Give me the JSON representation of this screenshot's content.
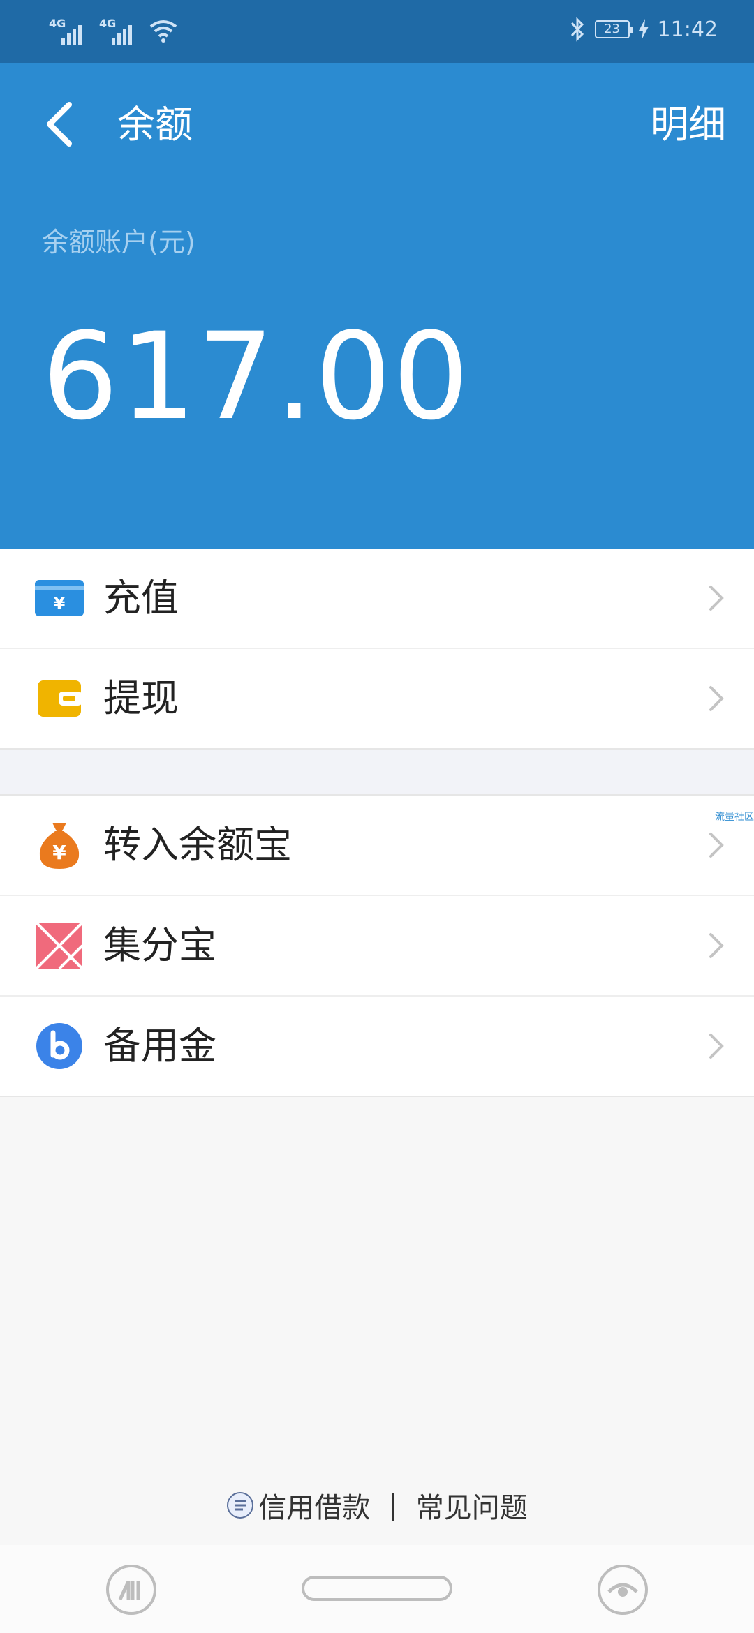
{
  "status_bar": {
    "sim1_type": "4G",
    "sim2_type": "4G",
    "battery_level": "23",
    "time": "11:42"
  },
  "header": {
    "title": "余额",
    "detail_label": "明细",
    "account_label": "余额账户(元)",
    "balance": "617.00"
  },
  "menu_group_1": {
    "items": [
      {
        "label": "充值",
        "icon": "yuan-card-icon"
      },
      {
        "label": "提现",
        "icon": "wallet-icon"
      }
    ]
  },
  "menu_group_2": {
    "items": [
      {
        "label": "转入余额宝",
        "icon": "money-bag-icon"
      },
      {
        "label": "集分宝",
        "icon": "jifenbao-icon"
      },
      {
        "label": "备用金",
        "icon": "beiyongjin-icon"
      }
    ]
  },
  "watermark": "流量社区",
  "footer": {
    "credit_loan_label": "信用借款",
    "separator": "|",
    "faq_label": "常见问题"
  },
  "colors": {
    "header_bg": "#2b8bd1",
    "status_bg": "#1f6aa6",
    "recharge_icon": "#2a8fe0",
    "withdraw_icon": "#f0b400",
    "moneybag_icon": "#ea7a1e",
    "jifenbao_icon": "#f06a7c",
    "beiyongjin_icon": "#3b83e8"
  }
}
